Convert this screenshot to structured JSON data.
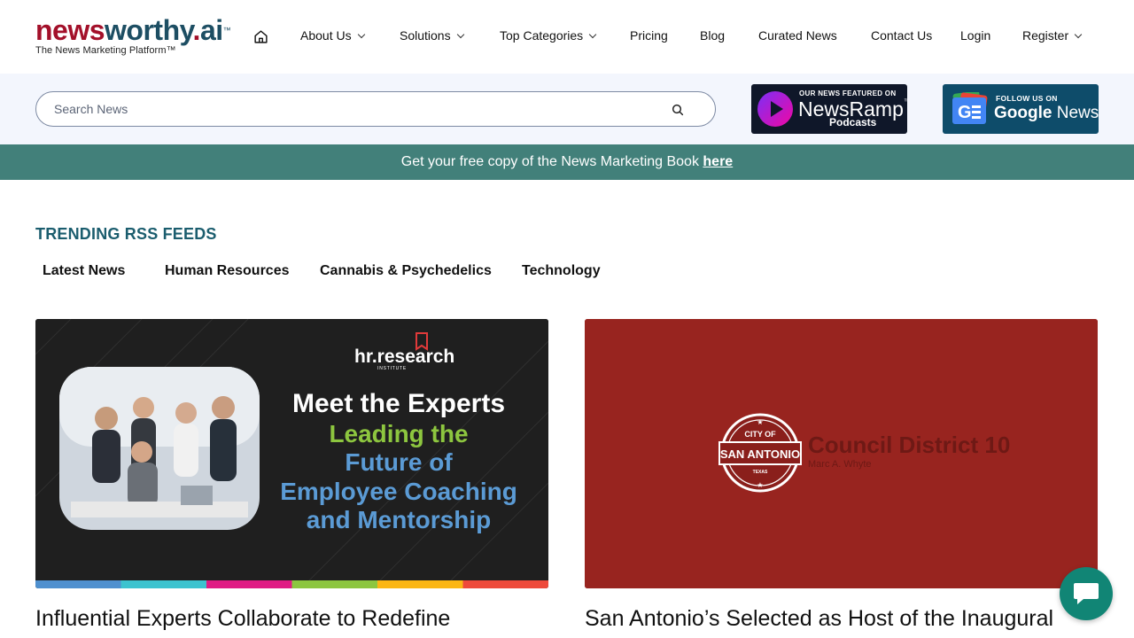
{
  "logo": {
    "brand_news": "news",
    "brand_worthy": "worthy",
    "brand_dot": ".",
    "brand_ai": "ai",
    "tm": "™",
    "tagline": "The News Marketing Platform™"
  },
  "nav": {
    "home_icon": "home-icon",
    "items": [
      {
        "label": "About Us",
        "dropdown": true
      },
      {
        "label": "Solutions",
        "dropdown": true
      },
      {
        "label": "Top Categories",
        "dropdown": true
      },
      {
        "label": "Pricing",
        "dropdown": false
      },
      {
        "label": "Blog",
        "dropdown": false
      },
      {
        "label": "Curated News",
        "dropdown": false
      },
      {
        "label": "Contact Us",
        "dropdown": false
      },
      {
        "label": "Login",
        "dropdown": false
      },
      {
        "label": "Register",
        "dropdown": true
      }
    ]
  },
  "search": {
    "placeholder": "Search News",
    "icon": "search-icon"
  },
  "badges": {
    "newsramp": {
      "line1": "OUR NEWS FEATURED ON",
      "brand": "NewsRamp",
      "tm": "™",
      "line3": "Podcasts"
    },
    "google_news": {
      "line1": "FOLLOW US ON",
      "brand_google": "Google",
      "brand_news": "News"
    }
  },
  "promo": {
    "text": "Get your free copy of the News Marketing Book ",
    "link": "here"
  },
  "trending": {
    "title": "TRENDING RSS FEEDS",
    "tabs": [
      "Latest News",
      "Human Resources",
      "Cannabis & Psychedelics",
      "Technology"
    ]
  },
  "cards": [
    {
      "image": {
        "logo": "hr.research",
        "logo_sub": "INSTITUTE",
        "heading1": "Meet the Experts",
        "heading2": "Leading the",
        "heading3": "Future of",
        "heading4": "Employee Coaching",
        "heading5": "and Mentorship",
        "stripe_colors": [
          "#4f90cf",
          "#3cc3cf",
          "#e01b84",
          "#8cc63f",
          "#fbb614",
          "#ee4a3b"
        ]
      },
      "title": "Influential Experts Collaborate to Redefine"
    },
    {
      "image": {
        "seal_top": "CITY OF",
        "seal_main": "SAN ANTONIO",
        "seal_bottom": "TEXAS",
        "district": "Council District 10",
        "subtitle": "Marc A. Whyte"
      },
      "title": "San Antonio’s Selected as Host of the Inaugural"
    }
  ],
  "chat": {
    "icon": "chat-bubble-icon"
  },
  "colors": {
    "brand_red": "#a3102a",
    "brand_blue": "#1d4e63",
    "promo_bg": "#42807a",
    "trend_title": "#1b5d6e",
    "chat_bg": "#118575"
  }
}
